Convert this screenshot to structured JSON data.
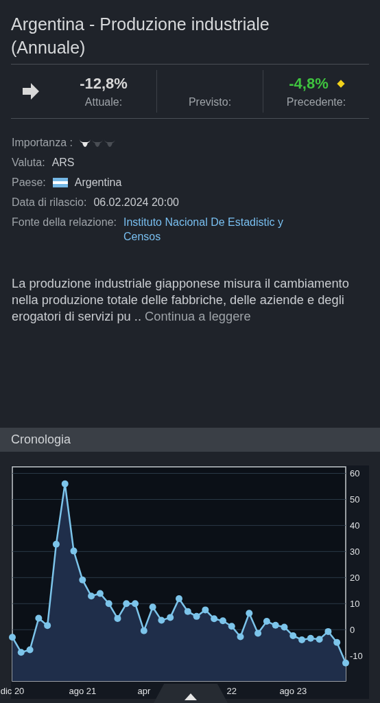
{
  "title": "Argentina - Produzione industriale (Annuale)",
  "stats": [
    {
      "kind": "actual",
      "value": "-12,8%",
      "label": "Attuale:"
    },
    {
      "kind": "forecast",
      "label": "Previsto:"
    },
    {
      "kind": "previous",
      "value": "-4,8%",
      "label": "Precedente:",
      "color": "#3fc33f",
      "revised": true
    }
  ],
  "details": [
    {
      "kind": "importance",
      "label": "Importanza :",
      "stars": 1
    },
    {
      "kind": "text",
      "label": "Valuta:",
      "value": "ARS"
    },
    {
      "kind": "country",
      "label": "Paese:",
      "value": "Argentina"
    },
    {
      "kind": "text",
      "label": "Data di rilascio:",
      "value": "06.02.2024 20:00"
    },
    {
      "kind": "link",
      "label": "Fonte della relazione:",
      "value": "Instituto Nacional De Estadistic y Censos"
    }
  ],
  "description": {
    "text": "La produzione industriale giapponese misura il cambiamento nella produzione totale delle fabbriche, delle aziende e degli erogatori di servizi pu ..",
    "more": "Continua a leggere"
  },
  "history": {
    "title": "Cronologia",
    "chart_data": {
      "type": "area",
      "categories": [
        "dic 20",
        null,
        null,
        null,
        null,
        null,
        null,
        null,
        "ago 21",
        null,
        null,
        null,
        null,
        null,
        null,
        "apr",
        null,
        null,
        null,
        null,
        null,
        null,
        null,
        null,
        null,
        "22",
        null,
        null,
        null,
        null,
        null,
        null,
        "ago 23",
        null,
        null,
        null,
        null,
        null,
        null
      ],
      "series": [
        {
          "color": "#7cc4ea",
          "values": [
            -2.9,
            -8.7,
            -7.7,
            4.4,
            1.6,
            32.8,
            56.0,
            30.2,
            19.1,
            12.9,
            13.9,
            10.0,
            4.3,
            10.0,
            10.0,
            -0.4,
            8.7,
            3.6,
            4.7,
            11.9,
            7.0,
            5.1,
            7.6,
            4.2,
            3.4,
            1.3,
            -2.7,
            6.3,
            -1.4,
            3.2,
            1.7,
            1.0,
            -2.3,
            -3.9,
            -3.3,
            -3.7,
            -0.7,
            -4.9,
            -12.8
          ]
        }
      ],
      "ylim": [
        -19.7,
        62.5
      ],
      "grid": true,
      "yticks": [
        -10,
        0,
        10,
        20,
        30,
        40,
        50,
        60
      ]
    }
  }
}
